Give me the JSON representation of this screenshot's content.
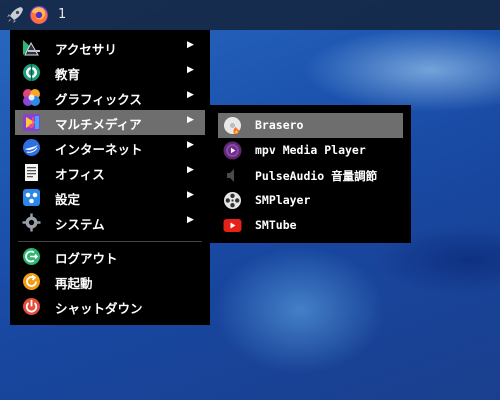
{
  "panel": {
    "launcher_icon": "rocket-icon",
    "browser_icon": "firefox-icon",
    "desktop_number": "1"
  },
  "menu": {
    "items": [
      {
        "label": "アクセサリ",
        "icon": "accessories-icon",
        "arrow": "▶"
      },
      {
        "label": "教育",
        "icon": "education-icon",
        "arrow": "▶"
      },
      {
        "label": "グラフィックス",
        "icon": "graphics-icon",
        "arrow": "▶"
      },
      {
        "label": "マルチメディア",
        "icon": "multimedia-icon",
        "arrow": "▶"
      },
      {
        "label": "インターネット",
        "icon": "internet-icon",
        "arrow": "▶"
      },
      {
        "label": "オフィス",
        "icon": "office-icon",
        "arrow": "▶"
      },
      {
        "label": "設定",
        "icon": "settings-icon",
        "arrow": "▶"
      },
      {
        "label": "システム",
        "icon": "system-icon",
        "arrow": "▶"
      }
    ],
    "actions": [
      {
        "label": "ログアウト",
        "icon": "logout-icon"
      },
      {
        "label": "再起動",
        "icon": "reboot-icon"
      },
      {
        "label": "シャットダウン",
        "icon": "shutdown-icon"
      }
    ],
    "highlighted": "マルチメディア"
  },
  "submenu": {
    "items": [
      {
        "label": "Brasero",
        "icon": "brasero-icon"
      },
      {
        "label": "mpv Media Player",
        "icon": "mpv-icon"
      },
      {
        "label": "PulseAudio 音量調節",
        "icon": "speaker-icon"
      },
      {
        "label": "SMPlayer",
        "icon": "smplayer-icon"
      },
      {
        "label": "SMTube",
        "icon": "smtube-icon"
      }
    ],
    "highlighted": "Brasero"
  },
  "colors": {
    "menu_bg": "#000000",
    "highlight": "#6e6e6e",
    "desktop": "#1c54b0"
  }
}
